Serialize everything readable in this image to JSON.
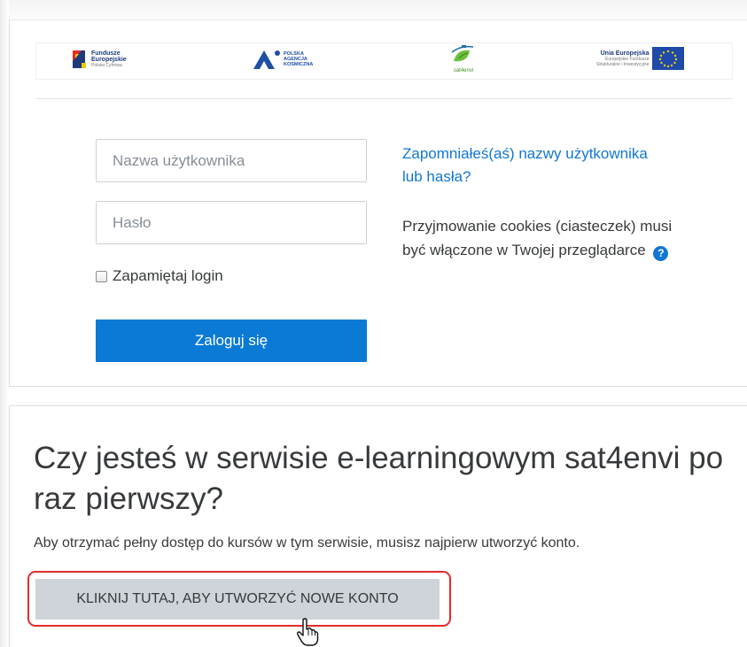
{
  "logos": {
    "fe_line1": "Fundusze",
    "fe_line2": "Europejskie",
    "fe_line3": "Polska Cyfrowa",
    "polsa_line1": "POLSKA",
    "polsa_line2": "AGENCJA",
    "polsa_line3": "KOSMICZNA",
    "sat_text": "sat4envi",
    "ue_line1": "Unia Europejska",
    "ue_line2": "Europejskie Fundusze",
    "ue_line3": "Strukturalne i Inwestycyjne"
  },
  "login": {
    "username_placeholder": "Nazwa użytkownika",
    "password_placeholder": "Hasło",
    "remember_label": "Zapamiętaj login",
    "login_button": "Zaloguj się",
    "forgot_link": "Zapomniałeś(aś) nazwy użytkownika lub hasła?",
    "cookies_text": "Przyjmowanie cookies (ciasteczek) musi być włączone w Twojej przeglądarce",
    "help_icon_glyph": "?"
  },
  "signup": {
    "heading": "Czy jesteś w serwisie e-learningowym sat4envi po raz pierwszy?",
    "intro": "Aby otrzymać pełny dostęp do kursów w tym serwisie, musisz najpierw utworzyć konto.",
    "create_button": "KLIKNIJ TUTAJ, ABY UTWORZYĆ NOWE KONTO"
  },
  "colors": {
    "primary": "#0a7ad5",
    "link": "#1177d1",
    "secondary_button": "#ced4da",
    "highlight_border": "#e42b2b"
  }
}
